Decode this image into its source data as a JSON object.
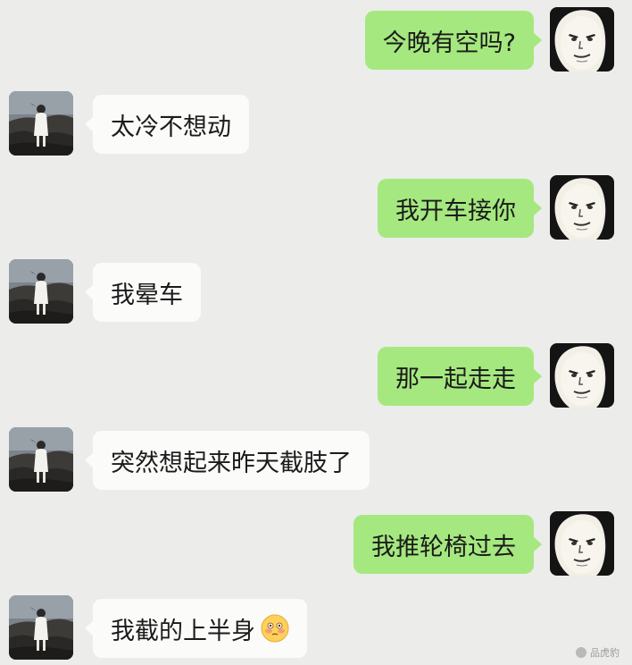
{
  "conversation": {
    "messages": [
      {
        "sender": "me",
        "text": "今晚有空吗?"
      },
      {
        "sender": "her",
        "text": "太冷不想动"
      },
      {
        "sender": "me",
        "text": "我开车接你"
      },
      {
        "sender": "her",
        "text": "我晕车"
      },
      {
        "sender": "me",
        "text": "那一起走走"
      },
      {
        "sender": "her",
        "text": "突然想起来昨天截肢了"
      },
      {
        "sender": "me",
        "text": "我推轮椅过去"
      },
      {
        "sender": "her",
        "text": "我截的上半身",
        "emoji": "flushed-face-emoji"
      }
    ]
  },
  "colors": {
    "background": "#ececea",
    "bubble_me": "#a5e87f",
    "bubble_her": "#fbfbfa"
  },
  "icons": {
    "my_avatar": "panda-meme-face-avatar",
    "her_avatar": "girl-on-rocks-photo-avatar",
    "emoji": "flushed-face-emoji"
  },
  "watermark": {
    "text": "品虎豹"
  }
}
